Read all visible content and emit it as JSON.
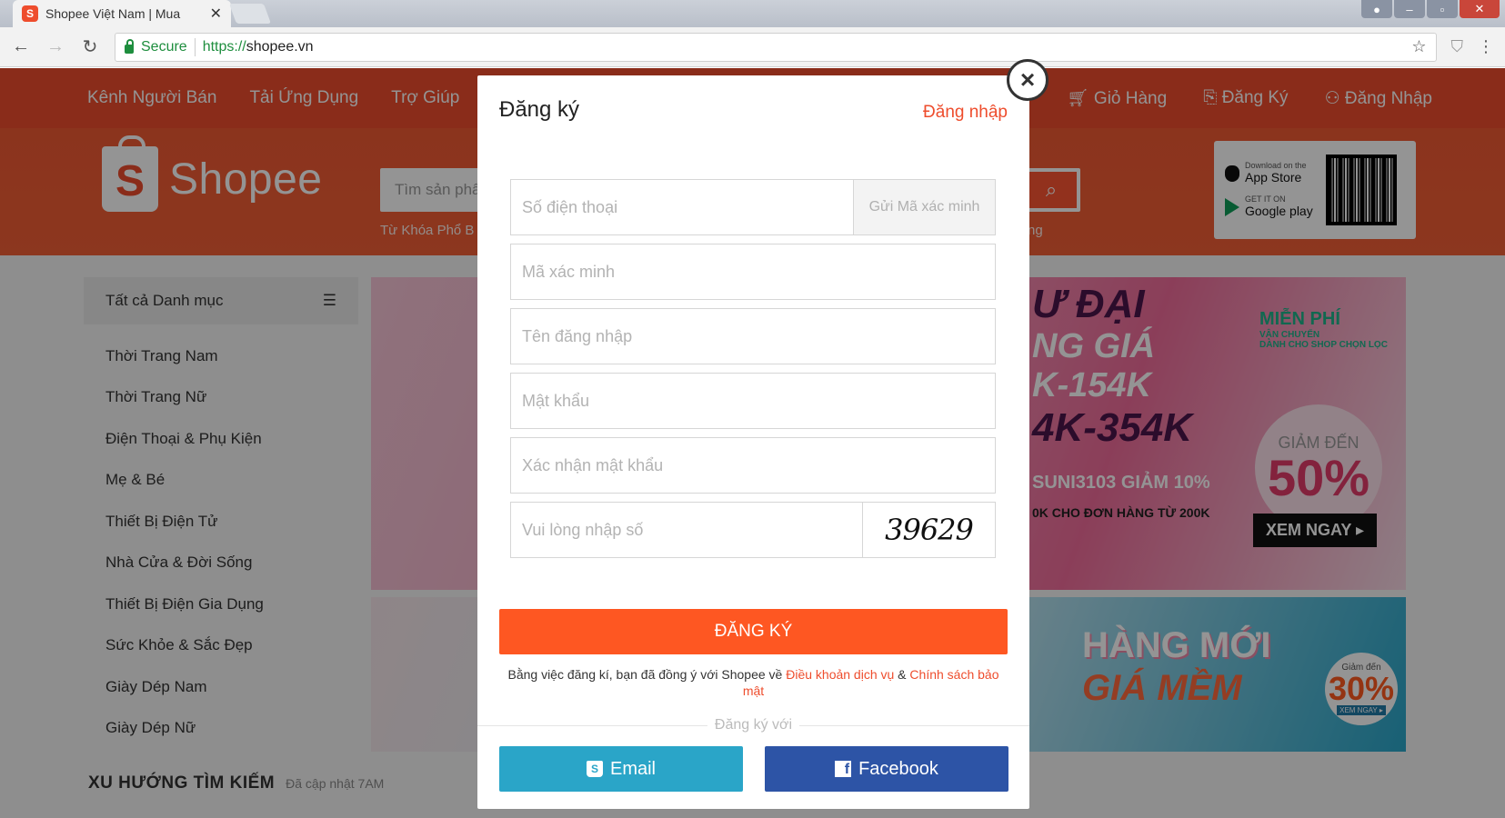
{
  "browser": {
    "tab_title": "Shopee Việt Nam | Mua",
    "tab_close": "✕",
    "secure_label": "Secure",
    "url_protocol": "https://",
    "url_host": "shopee.vn"
  },
  "header": {
    "left_links": [
      "Kênh Người Bán",
      "Tải Ứng Dụng",
      "Trợ Giúp"
    ],
    "right_links": [
      "Giỏ Hàng",
      "Đăng Ký",
      "Đăng Nhập"
    ],
    "logo_text": "Shopee",
    "logo_letter": "S",
    "search_placeholder": "Tìm sản phẩ",
    "keywords_prefix": "Từ Khóa Phổ B",
    "keywords_suffix": "ng",
    "app_store": "App Store",
    "app_store_small": "Download on the",
    "google_play": "Google play",
    "google_play_small": "GET IT ON"
  },
  "categories": {
    "title": "Tất cả Danh mục",
    "items": [
      "Thời Trang Nam",
      "Thời Trang Nữ",
      "Điện Thoại & Phụ Kiện",
      "Mẹ & Bé",
      "Thiết Bị Điện Tử",
      "Nhà Cửa & Đời Sống",
      "Thiết Bị Điện Gia Dụng",
      "Sức Khỏe & Sắc Đẹp",
      "Giày Dép Nam",
      "Giày Dép Nữ"
    ]
  },
  "banners": {
    "headline_1": "Ư ĐẠI",
    "headline_2": "NG GIÁ",
    "headline_3": "K-154K",
    "headline_4": "4K-354K",
    "code": "SUNI3103 GIẢM 10%",
    "sub": "0K CHO ĐƠN HÀNG TỪ 200K",
    "free_ship": "MIỄN PHÍ",
    "free_ship_sub": "VẬN CHUYỂN",
    "free_ship_note": "DÀNH CHO SHOP CHỌN LỌC",
    "discount_label": "GIẢM ĐẾN",
    "discount_value": "50%",
    "cta": "XEM NGAY ▸",
    "b2_line1": "HÀNG MỚI",
    "b2_line2": "GIÁ MỀM",
    "b2_badge_top": "Giảm đến",
    "b2_badge_value": "30%",
    "b2_badge_cta": "XEM NGAY ▸"
  },
  "trend": {
    "title": "XU HƯỚNG TÌM KIẾM",
    "updated": "Đã cập nhật 7AM"
  },
  "modal": {
    "title": "Đăng ký",
    "login_link": "Đăng nhập",
    "phone_placeholder": "Số điện thoại",
    "send_code": "Gửi Mã xác minh",
    "code_placeholder": "Mã xác minh",
    "username_placeholder": "Tên đăng nhập",
    "password_placeholder": "Mật khẩu",
    "confirm_placeholder": "Xác nhận mật khẩu",
    "captcha_placeholder": "Vui lòng nhập số",
    "captcha_value": "39629",
    "register_button": "ĐĂNG KÝ",
    "terms_prefix": "Bằng việc đăng kí, bạn đã đồng ý với Shopee về ",
    "terms_link": "Điều khoản dịch vụ",
    "terms_and": " & ",
    "privacy_link": "Chính sách bảo mật",
    "divider": "Đăng ký với",
    "email_button": "Email",
    "facebook_button": "Facebook",
    "close": "×"
  },
  "colors": {
    "brand": "#ee4d2d",
    "register_button": "#fe5722",
    "email_button": "#2aa5c8",
    "facebook_button": "#2d54a6"
  }
}
